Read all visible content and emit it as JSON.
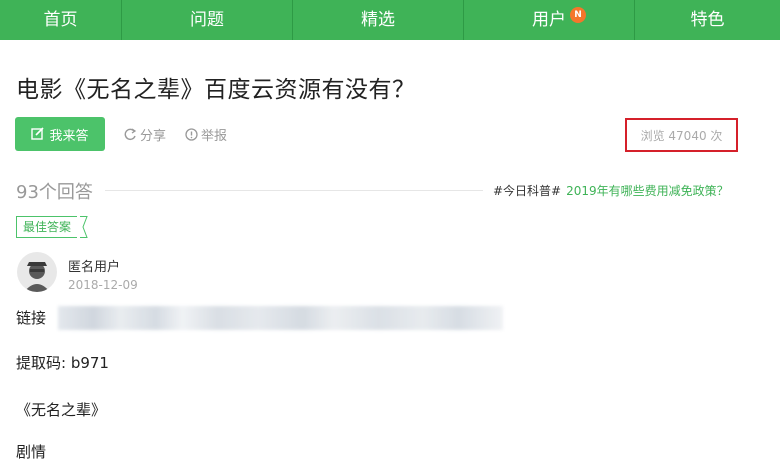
{
  "nav": {
    "items": [
      "首页",
      "问题",
      "精选",
      "用户",
      "特色"
    ],
    "badge": "N"
  },
  "question": {
    "title": "电影《无名之辈》百度云资源有没有？",
    "answer_button": "我来答",
    "share": "分享",
    "report": "举报",
    "views": "浏览 47040 次"
  },
  "answers": {
    "count": "93个回答",
    "promo_tag": "#今日科普#",
    "promo_link": "2019年有哪些费用减免政策？",
    "best_label": "最佳答案"
  },
  "best_answer": {
    "author": "匿名用户",
    "date": "2018-12-09",
    "link_label": "链接",
    "code_line": "提取码: b971",
    "movie_line": "《无名之辈》",
    "cut_line": "剧情"
  },
  "colors": {
    "brand_green": "#3fb357",
    "badge_orange": "#f4762b",
    "highlight_red": "#d5202a"
  }
}
